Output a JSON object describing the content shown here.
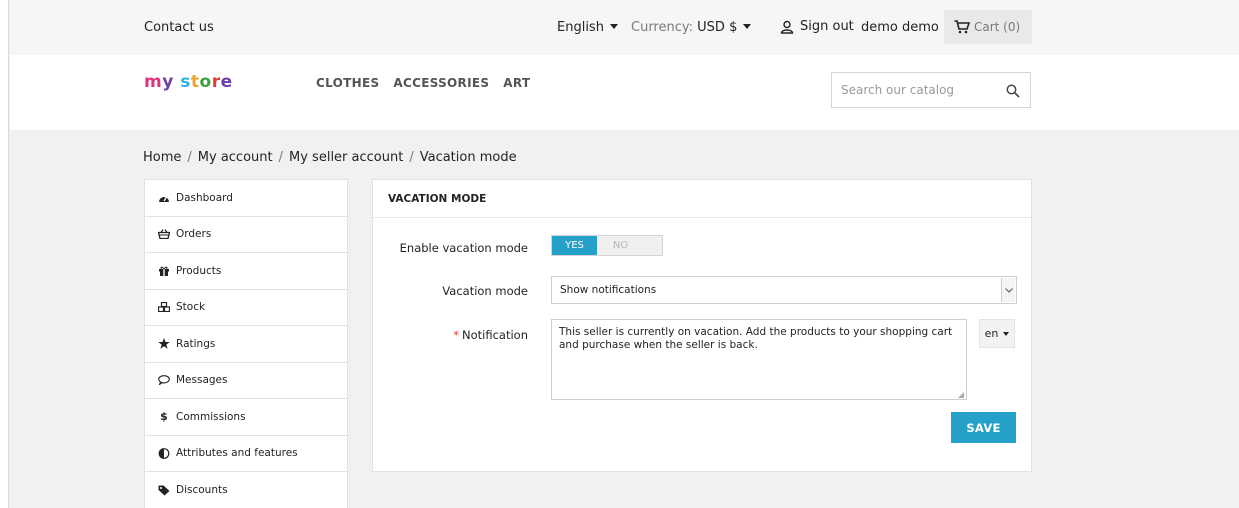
{
  "topbar": {
    "contact": "Contact us",
    "language": "English",
    "currency_label": "Currency:",
    "currency_value": "USD $",
    "signout": "Sign out",
    "username": "demo demo",
    "cart": "Cart (0)"
  },
  "header": {
    "logo": {
      "m": "m",
      "y": "y",
      "s": "s",
      "t": "t",
      "o": "o",
      "r": "r",
      "e": "e"
    },
    "nav": [
      "CLOTHES",
      "ACCESSORIES",
      "ART"
    ],
    "search_placeholder": "Search our catalog"
  },
  "breadcrumb": [
    "Home",
    "My account",
    "My seller account",
    "Vacation mode"
  ],
  "breadcrumb_sep": "/",
  "sidebar": {
    "items": [
      {
        "icon": "dashboard-icon",
        "label": "Dashboard"
      },
      {
        "icon": "orders-icon",
        "label": "Orders"
      },
      {
        "icon": "gift-icon",
        "label": "Products"
      },
      {
        "icon": "cubes-icon",
        "label": "Stock"
      },
      {
        "icon": "star-icon",
        "label": "Ratings"
      },
      {
        "icon": "comment-icon",
        "label": "Messages"
      },
      {
        "icon": "dollar-icon",
        "label": "Commissions"
      },
      {
        "icon": "adjust-icon",
        "label": "Attributes and features"
      },
      {
        "icon": "tag-icon",
        "label": "Discounts"
      }
    ]
  },
  "panel": {
    "title": "VACATION MODE",
    "enable_label": "Enable vacation mode",
    "toggle_yes": "YES",
    "toggle_no": "NO",
    "toggle_selected": "YES",
    "mode_label": "Vacation mode",
    "mode_value": "Show notifications",
    "required_mark": "*",
    "notification_label": "Notification",
    "notification_text": "This seller is currently on vacation. Add the products to your shopping cart and purchase when the seller is back.",
    "lang": "en",
    "save": "SAVE"
  },
  "colors": {
    "accent": "#25a1c9",
    "required": "#e53c2d"
  }
}
